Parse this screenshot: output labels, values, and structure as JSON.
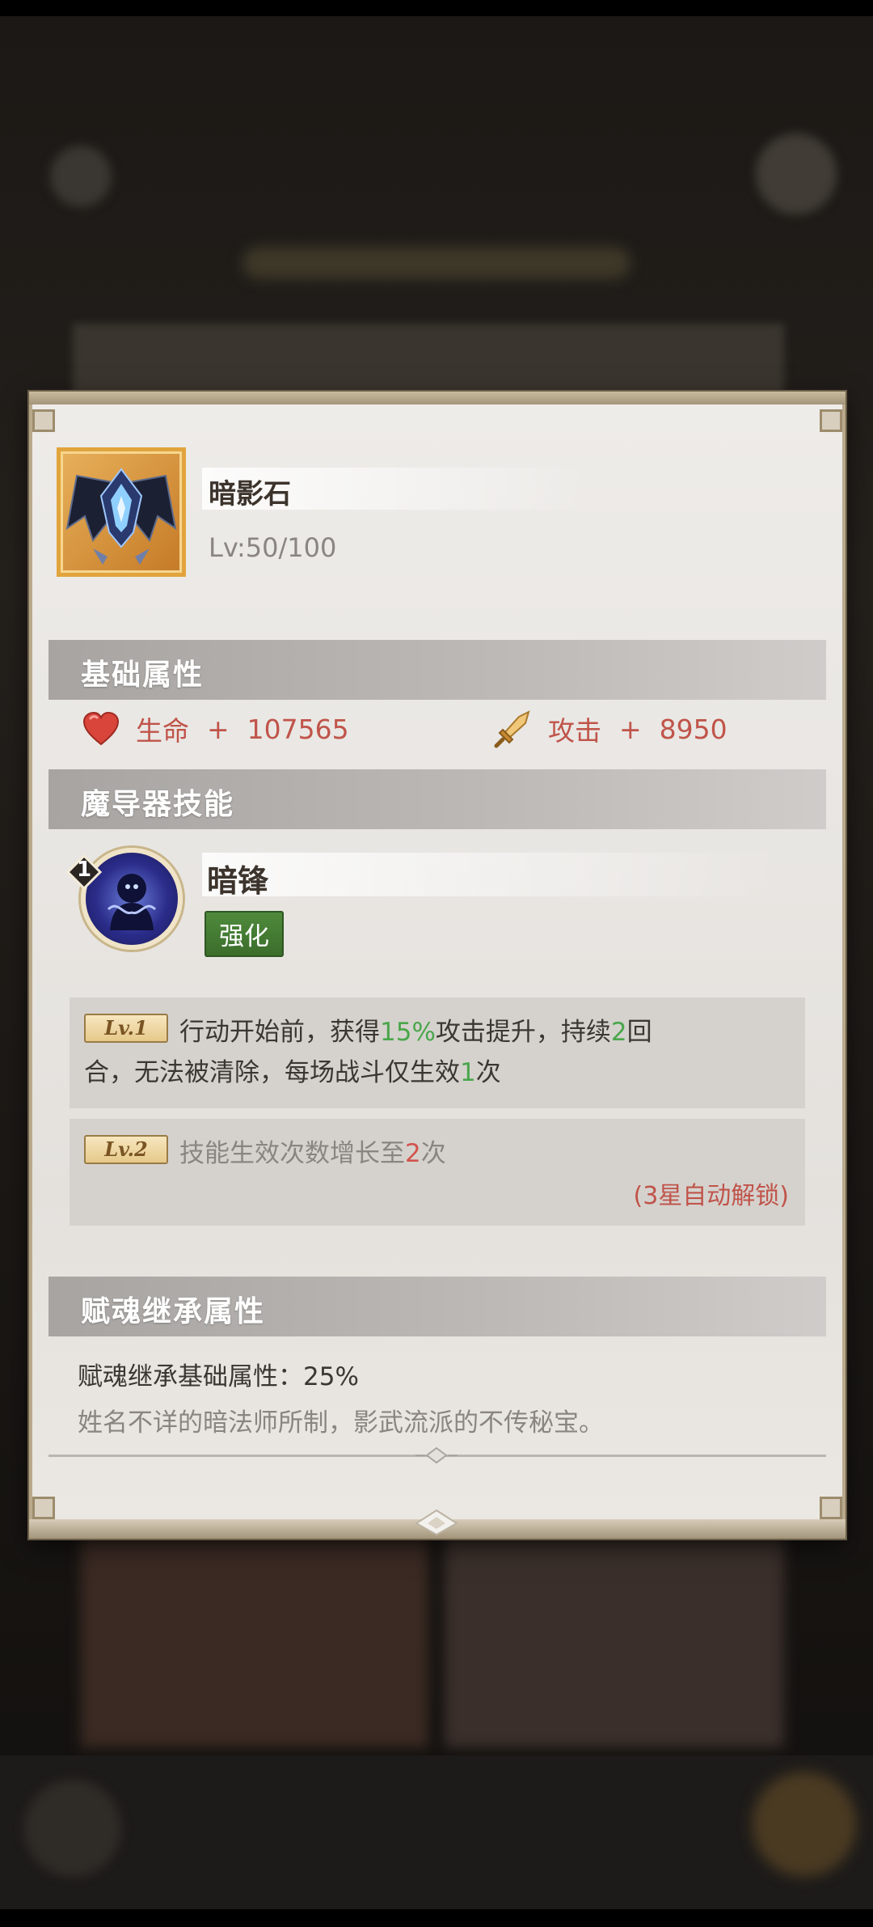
{
  "item": {
    "name": "暗影石",
    "level": "Lv:50/100"
  },
  "sections": {
    "basic": "基础属性",
    "skill": "魔导器技能",
    "inherit": "赋魂继承属性"
  },
  "stats": [
    {
      "icon": "heart-icon",
      "name": "生命",
      "plus": "+",
      "value": "107565",
      "color": "#c0544a"
    },
    {
      "icon": "sword-icon",
      "name": "攻击",
      "plus": "+",
      "value": "8950",
      "color": "#c0544a"
    }
  ],
  "skill": {
    "badge": "1",
    "name": "暗锋",
    "tag": "强化",
    "levels": [
      {
        "tag": "Lv.1",
        "parts": [
          "行动开始前，获得",
          "15%",
          "攻击提升，持续",
          "2",
          "回合，无法被清除，每场战斗仅生效",
          "1",
          "次"
        ]
      },
      {
        "tag": "Lv.2",
        "parts": [
          "技能生效次数增长至",
          "2",
          "次"
        ],
        "note": "(3星自动解锁)"
      }
    ]
  },
  "inherit": {
    "line": "赋魂继承基础属性：25%",
    "description": "姓名不详的暗法师所制，影武流派的不传秘宝。"
  },
  "colors": {
    "accent_red": "#c0544a",
    "accent_green": "#4aa64a",
    "tag_green": "#4f8b3c",
    "frame_gold": "#e1a43c"
  }
}
